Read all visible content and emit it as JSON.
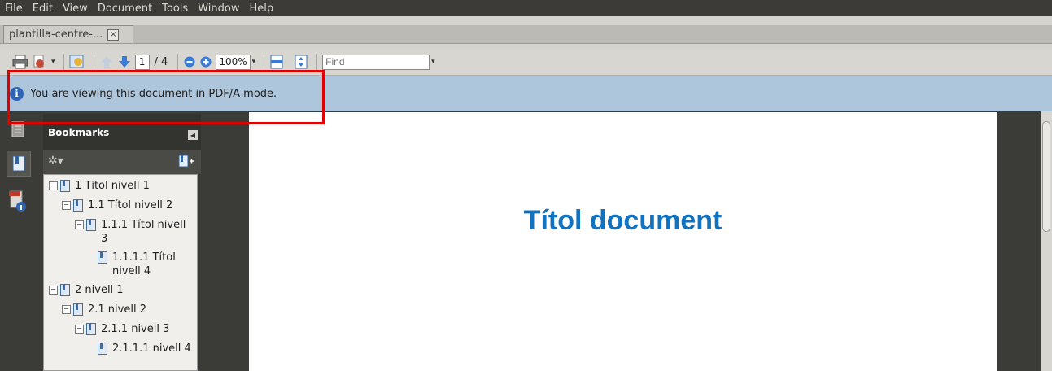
{
  "menu": [
    "File",
    "Edit",
    "View",
    "Document",
    "Tools",
    "Window",
    "Help"
  ],
  "tab": {
    "label": "plantilla-centre-...",
    "close": "×"
  },
  "toolbar": {
    "page_current": "1",
    "page_total": "/ 4",
    "zoom": "100%",
    "find_placeholder": "Find"
  },
  "infobar": {
    "message": "You are viewing this document in PDF/A mode.",
    "icon_glyph": "i"
  },
  "bookmarks": {
    "title": "Bookmarks",
    "items": [
      {
        "label": "1 Títol nivell 1"
      },
      {
        "label": "1.1 Títol nivell 2"
      },
      {
        "label": "1.1.1 Títol nivell 3"
      },
      {
        "label": "1.1.1.1 Títol nivell 4"
      },
      {
        "label": "2 nivell 1"
      },
      {
        "label": "2.1 nivell 2"
      },
      {
        "label": "2.1.1 nivell 3"
      },
      {
        "label": "2.1.1.1 nivell 4"
      }
    ]
  },
  "document": {
    "title": "Títol document"
  },
  "colors": {
    "accent": "#1172c0",
    "infobar": "#aec6dc",
    "highlight": "#e00000"
  }
}
